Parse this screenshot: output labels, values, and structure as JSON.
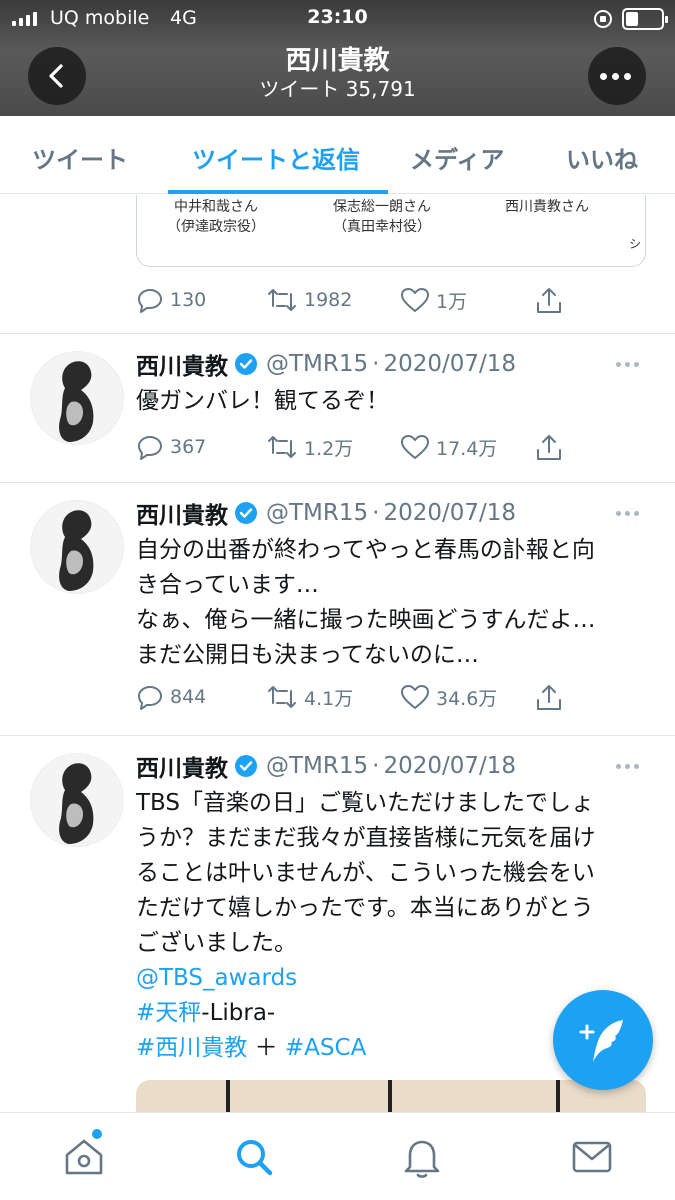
{
  "status_bar": {
    "carrier": "UQ mobile",
    "network": "4G",
    "time": "23:10"
  },
  "header": {
    "name": "西川貴教",
    "tweet_count": "ツイート 35,791"
  },
  "tabs": [
    {
      "label": "ツイート",
      "active": false
    },
    {
      "label": "ツイートと返信",
      "active": true
    },
    {
      "label": "メディア",
      "active": false
    },
    {
      "label": "いいね",
      "active": false
    }
  ],
  "card_preview": {
    "cast": [
      {
        "name": "中井和哉さん",
        "role": "（伊達政宗役）"
      },
      {
        "name": "保志総一朗さん",
        "role": "（真田幸村役）"
      },
      {
        "name": "西川貴教さん",
        "role": ""
      }
    ],
    "extra": "シ"
  },
  "first_actions": {
    "replies": "130",
    "retweets": "1982",
    "likes": "1万"
  },
  "tweets": [
    {
      "name": "西川貴教",
      "handle": "@TMR15",
      "sep": "·",
      "date": "2020/07/18",
      "lines": [
        "優ガンバレ！観てるぞ！"
      ],
      "replies": "367",
      "retweets": "1.2万",
      "likes": "17.4万"
    },
    {
      "name": "西川貴教",
      "handle": "@TMR15",
      "sep": "·",
      "date": "2020/07/18",
      "lines": [
        "自分の出番が終わってやっと春馬の訃報と向",
        "き合っています…",
        "なぁ、俺ら一緒に撮った映画どうすんだよ…",
        "まだ公開日も決まってないのに…"
      ],
      "replies": "844",
      "retweets": "4.1万",
      "likes": "34.6万"
    },
    {
      "name": "西川貴教",
      "handle": "@TMR15",
      "sep": "·",
      "date": "2020/07/18",
      "lines": [
        "TBS「音楽の日」ご覧いただけましたでしょ",
        "うか？まだまだ我々が直接皆様に元気を届け",
        "ることは叶いませんが、こういった機会をい",
        "ただけて嬉しかったです。本当にありがとう",
        "ございました。"
      ],
      "mention": "@TBS_awards",
      "hashtag1": "#天秤",
      "tag1_rest": "-Libra-",
      "hashtag2": "#西川貴教",
      "plus": " ＋ ",
      "hashtag3": "#ASCA"
    }
  ],
  "icons": {
    "back": "chevron-left-icon",
    "more": "more-icon",
    "reply": "reply-icon",
    "retweet": "retweet-icon",
    "like": "heart-icon",
    "share": "share-icon",
    "verified": "verified-badge-icon",
    "compose": "compose-tweet-icon",
    "home": "home-icon",
    "search": "search-icon",
    "notifications": "bell-icon",
    "messages": "mail-icon"
  },
  "colors": {
    "accent": "#1da1f2",
    "muted": "#657786"
  }
}
